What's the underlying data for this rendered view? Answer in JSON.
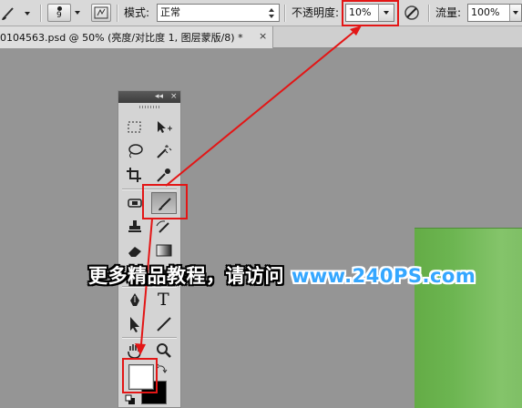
{
  "options_bar": {
    "brush_size": "9",
    "mode_label": "模式:",
    "mode_value": "正常",
    "opacity_label": "不透明度:",
    "opacity_value": "10%",
    "flow_label": "流量:",
    "flow_value": "100%"
  },
  "document_tab": {
    "title": "0104563.psd @ 50% (亮度/对比度 1, 图层蒙版/8) *",
    "close_glyph": "×"
  },
  "tools_panel": {
    "collapse_glyph": "◂◂",
    "close_glyph": "×",
    "type_tool_glyph": "T",
    "selected_tool": "brush-tool"
  },
  "colors": {
    "foreground": "#ffffff",
    "background": "#000000",
    "annotation_red": "#e31616",
    "canvas_green": "#6cb551"
  },
  "watermark": {
    "chinese_text": "更多精品教程，请访问",
    "url_text": "www.240PS.com"
  }
}
